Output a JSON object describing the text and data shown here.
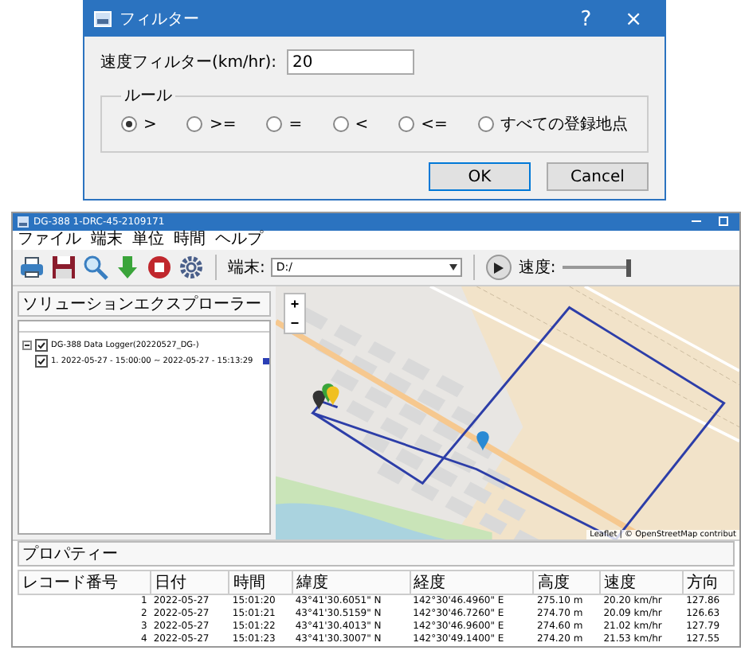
{
  "filter_dialog": {
    "title": "フィルター",
    "help": "?",
    "close": "×",
    "speed_label": "速度フィルター(km/hr):",
    "speed_value": "20",
    "group": "ルール",
    "options": [
      {
        "label": ">",
        "selected": true
      },
      {
        "label": ">=",
        "selected": false
      },
      {
        "label": "=",
        "selected": false
      },
      {
        "label": "<",
        "selected": false
      },
      {
        "label": "<=",
        "selected": false
      },
      {
        "label": "すべての登録地点",
        "selected": false
      }
    ],
    "buttons": [
      "OK",
      "Cancel"
    ]
  },
  "app": {
    "title": "DG-388 1-DRC-45-2109171",
    "menu": [
      "ファイル",
      "端末",
      "単位",
      "時間",
      "ヘルプ"
    ],
    "terminal_label": "端末:",
    "terminal_value": "D:/",
    "speed_label": "速度:",
    "speed_slider": {
      "level": 1
    },
    "explorer_title": "ソリューションエクスプローラー",
    "tree": [
      {
        "label": "DG-388 Data Logger(20220527_DG-)",
        "checked": true,
        "expanded": true,
        "children": [
          {
            "label": "1. 2022-05-27 - 15:00:00 ~ 2022-05-27 - 15:13:29",
            "checked": true,
            "color": "#2b3fb5"
          }
        ]
      }
    ],
    "map": {
      "zoom_in": "+",
      "zoom_out": "−",
      "attribution": "Leaflet | © OpenStreetMap contribut"
    },
    "properties_title": "プロパティー",
    "table": {
      "columns": [
        "レコード番号",
        "日付",
        "時間",
        "緯度",
        "経度",
        "高度",
        "速度",
        "方向"
      ],
      "rows": [
        [
          "1",
          "2022-05-27",
          "15:01:20",
          "43°41'30.6051\" N",
          "142°30'46.4960\" E",
          "275.10 m",
          "20.20 km/hr",
          "127.86"
        ],
        [
          "2",
          "2022-05-27",
          "15:01:21",
          "43°41'30.5159\" N",
          "142°30'46.7260\" E",
          "274.70 m",
          "20.09 km/hr",
          "126.63"
        ],
        [
          "3",
          "2022-05-27",
          "15:01:22",
          "43°41'30.4013\" N",
          "142°30'46.9600\" E",
          "274.60 m",
          "21.02 km/hr",
          "127.79"
        ],
        [
          "4",
          "2022-05-27",
          "15:01:23",
          "43°41'30.3007\" N",
          "142°30'49.1400\" E",
          "274.20 m",
          "21.53 km/hr",
          "127.55"
        ]
      ]
    }
  }
}
